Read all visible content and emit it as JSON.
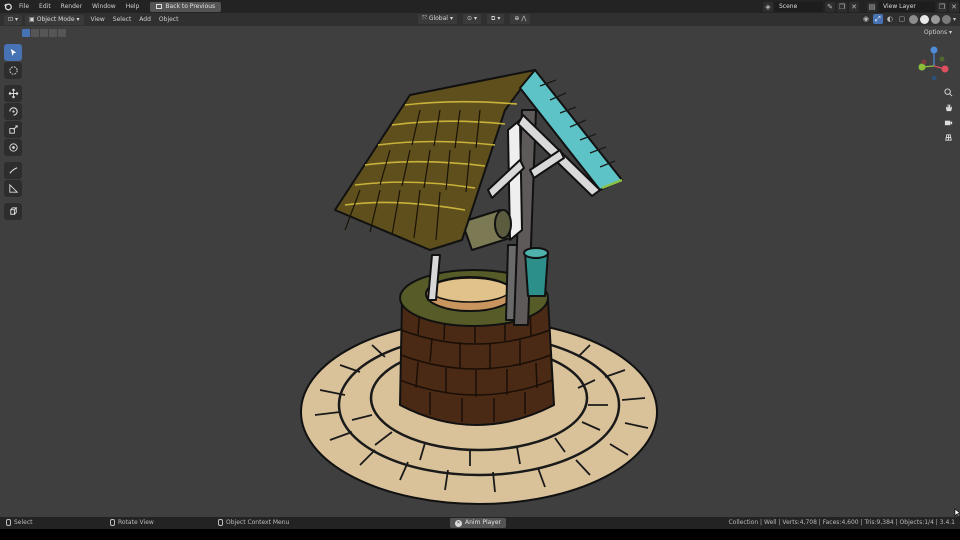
{
  "topbar": {
    "menus": [
      "File",
      "Edit",
      "Render",
      "Window",
      "Help"
    ],
    "back_label": "Back to Previous",
    "scene": "Scene",
    "view_layer": "View Layer"
  },
  "header": {
    "mode": "Object Mode",
    "menus": [
      "View",
      "Select",
      "Add",
      "Object"
    ],
    "orientation": "Global"
  },
  "subheader": {
    "options": "Options"
  },
  "toolbar": {
    "tools": [
      "select-box",
      "cursor",
      "move",
      "rotate",
      "scale",
      "transform",
      "annotate",
      "measure",
      "add-cube"
    ]
  },
  "gizmo": {
    "x": "X",
    "y": "Y",
    "z": "Z"
  },
  "statusbar": {
    "select": "Select",
    "rotate": "Rotate View",
    "context": "Object Context Menu",
    "anim_player": "Anim Player",
    "stats": "Collection | Well | Verts:4,708 | Faces:4,600 | Tris:9,384 | Objects:1/4 | 3.4.1"
  },
  "colors": {
    "accent": "#4772b3",
    "viewport_bg": "#3f3f3f",
    "roof": "#5e4f1c",
    "roof_tiles_teal": "#5ec3c7",
    "bricks": "#4a2a15",
    "cobbles": "#d9c29a"
  }
}
